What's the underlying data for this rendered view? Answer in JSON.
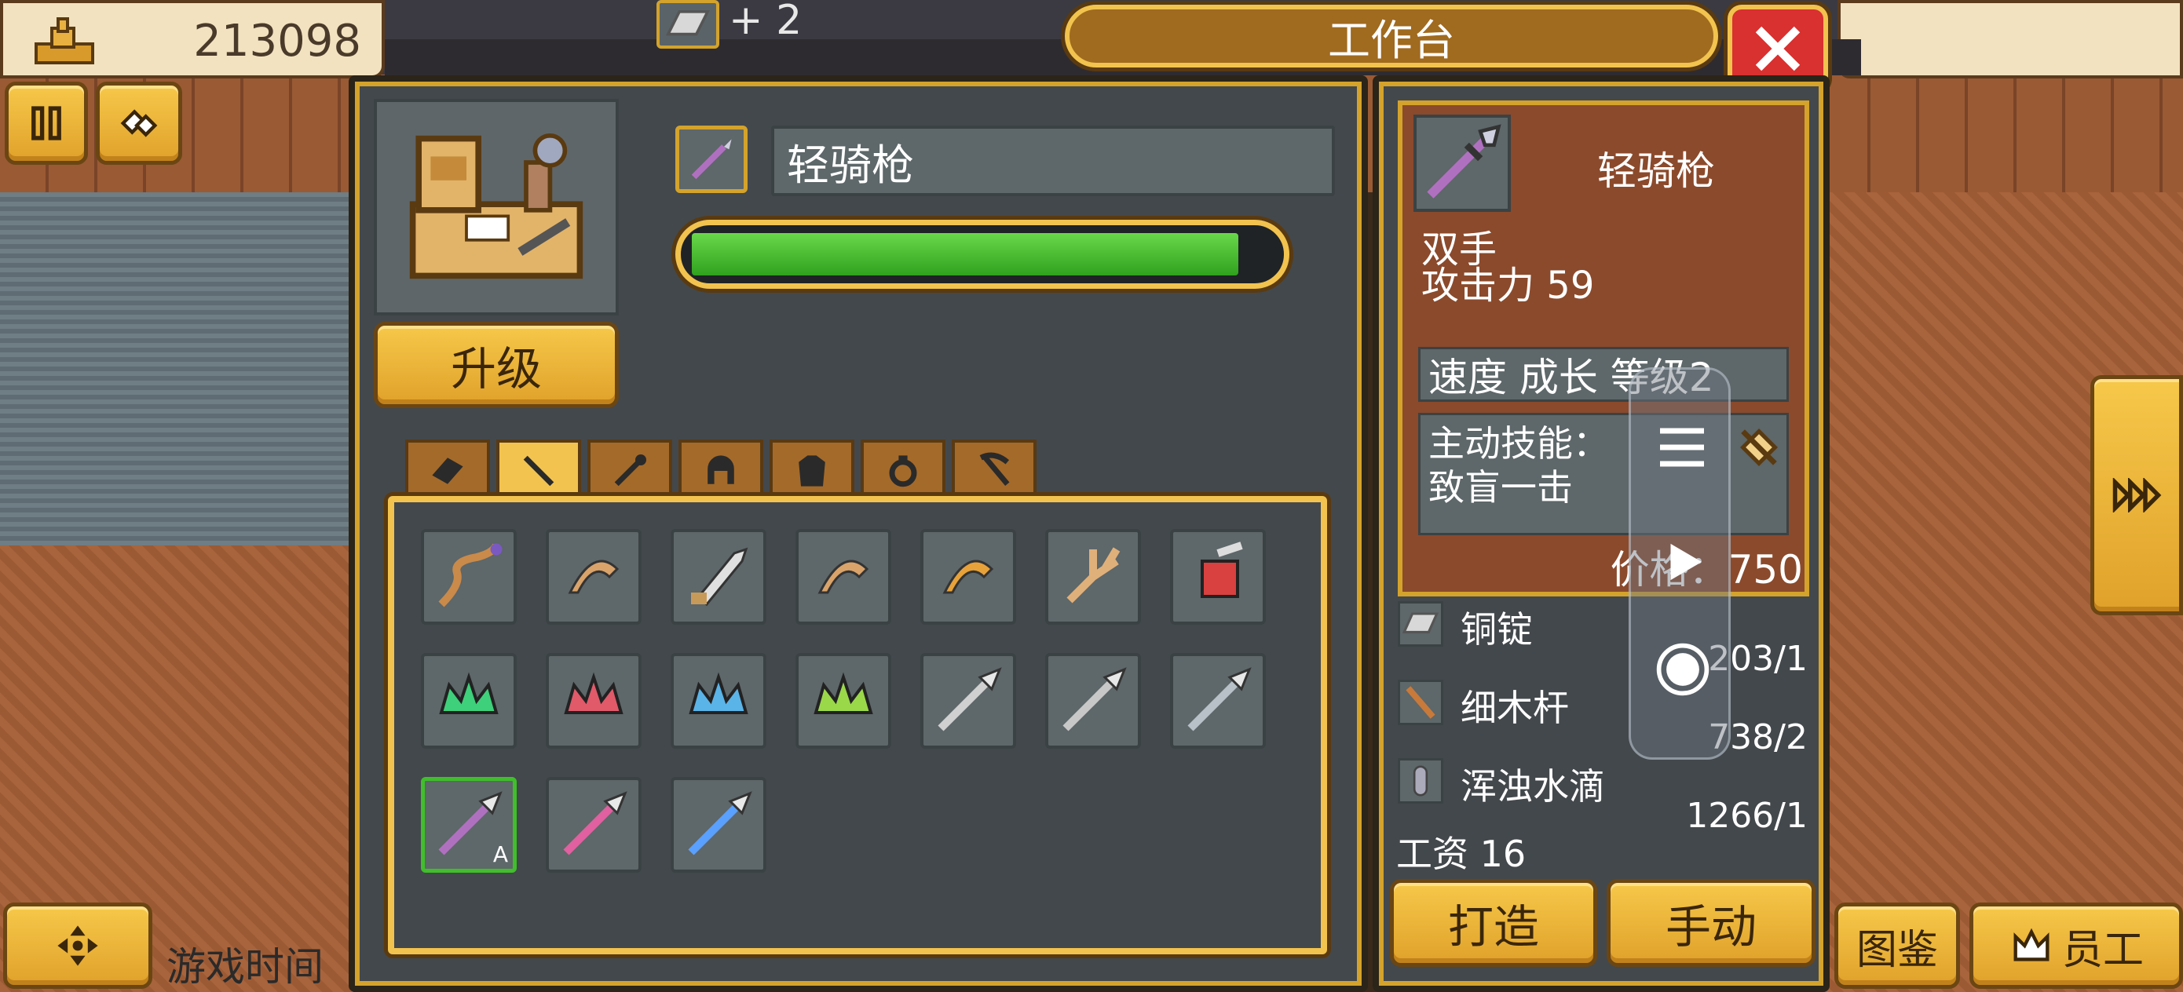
{
  "hud": {
    "money": "213098",
    "pickup_text": "+ 2",
    "game_time_label": "游戏时间"
  },
  "workbench": {
    "title": "工作台",
    "upgrade_label": "升级",
    "selected_name": "轻骑枪",
    "progress_fraction": 0.94
  },
  "tabs": [
    {
      "name": "tab-material",
      "icon": "material-icon",
      "active": false
    },
    {
      "name": "tab-spear",
      "icon": "spear-icon",
      "active": true
    },
    {
      "name": "tab-staff",
      "icon": "staff-icon",
      "active": false
    },
    {
      "name": "tab-helmet",
      "icon": "helmet-icon",
      "active": false
    },
    {
      "name": "tab-armor",
      "icon": "armor-icon",
      "active": false
    },
    {
      "name": "tab-accessory",
      "icon": "ring-icon",
      "active": false
    },
    {
      "name": "tab-tool",
      "icon": "pickaxe-icon",
      "active": false
    }
  ],
  "items": [
    {
      "icon": "twisted-staff-icon",
      "color": "#c98a4a"
    },
    {
      "icon": "bow-frame-icon",
      "color": "#d9a36a"
    },
    {
      "icon": "blade-hilt-icon",
      "color": "#e0e0e0"
    },
    {
      "icon": "crossbow-icon",
      "color": "#d9a36a"
    },
    {
      "icon": "golden-crossbow-icon",
      "color": "#e8a23a"
    },
    {
      "icon": "fork-icon",
      "color": "#e0b07a"
    },
    {
      "icon": "red-axe-icon",
      "color": "#d94040"
    },
    {
      "icon": "green-wreath-icon",
      "color": "#3ed07a"
    },
    {
      "icon": "red-crown-icon",
      "color": "#e05a6a"
    },
    {
      "icon": "blue-crown-icon",
      "color": "#5ab4e8"
    },
    {
      "icon": "green-vine-icon",
      "color": "#9ad84a"
    },
    {
      "icon": "spear-icon",
      "color": "#d0d0d0"
    },
    {
      "icon": "glaive-icon",
      "color": "#c8c8c8"
    },
    {
      "icon": "shovel-spear-icon",
      "color": "#b8c0c8"
    },
    {
      "icon": "light-lance-icon",
      "color": "#b070c0",
      "selected": true,
      "badge": "A"
    },
    {
      "icon": "crystal-spear-icon",
      "color": "#e060a0"
    },
    {
      "icon": "ice-spear-icon",
      "color": "#5aa0ff"
    }
  ],
  "detail": {
    "name": "轻骑枪",
    "hands": "双手",
    "attack_label": "攻击力",
    "attack": "59",
    "traits_line": "速度 成长 等级2",
    "skill_label": "主动技能：",
    "skill_name": "致盲一击",
    "price_label": "价格：",
    "price": "750"
  },
  "materials": [
    {
      "name": "铜锭",
      "count": "203/1",
      "icon": "copper-ingot-icon"
    },
    {
      "name": "细木杆",
      "count": "738/2",
      "icon": "wood-stick-icon"
    },
    {
      "name": "浑浊水滴",
      "count": "1266/1",
      "icon": "water-drop-icon"
    }
  ],
  "wage_label": "工资",
  "wage": "16",
  "actions": {
    "craft": "打造",
    "manual": "手动"
  },
  "bottom": {
    "catalog": "图鉴",
    "staff": "员工"
  },
  "colors": {
    "accent_gold": "#f2c34e",
    "panel": "#43484c",
    "detail_bg": "#8b4a2c",
    "progress": "#3fbf2a",
    "close_red": "#d93030"
  }
}
